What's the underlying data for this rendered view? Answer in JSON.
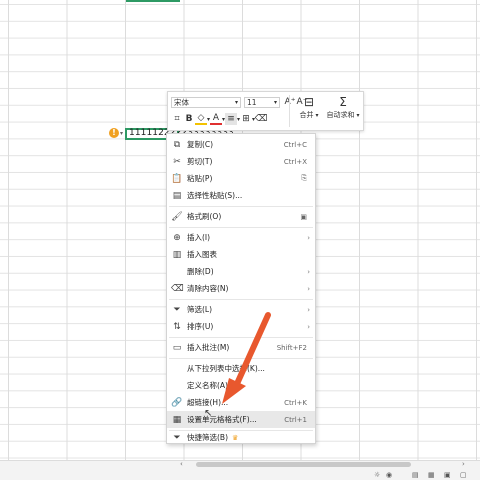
{
  "cell": {
    "value": "111112222233333333",
    "warning_glyph": "!"
  },
  "mini_toolbar": {
    "font_name": "宋体",
    "font_size": "11",
    "grow_font": "A⁺",
    "shrink_font": "A⁻",
    "bold": "B",
    "merge_label": "合并",
    "autosum_label": "自动求和"
  },
  "context_menu": {
    "items": [
      {
        "icon": "copy-icon",
        "label": "复制(C)",
        "shortcut": "Ctrl+C"
      },
      {
        "icon": "cut-icon",
        "label": "剪切(T)",
        "shortcut": "Ctrl+X"
      },
      {
        "icon": "paste-icon",
        "label": "粘贴(P)",
        "shortcut": ""
      },
      {
        "icon": "paste-special-icon",
        "label": "选择性粘贴(S)...",
        "shortcut": ""
      },
      {
        "icon": "format-painter-icon",
        "label": "格式刷(O)",
        "shortcut": ""
      },
      {
        "icon": "insert-icon",
        "label": "插入(I)",
        "shortcut": ""
      },
      {
        "icon": "chart-icon",
        "label": "插入图表",
        "shortcut": ""
      },
      {
        "icon": "delete-icon",
        "label": "删除(D)",
        "shortcut": ""
      },
      {
        "icon": "eraser-icon",
        "label": "清除内容(N)",
        "shortcut": ""
      },
      {
        "icon": "filter-icon",
        "label": "筛选(L)",
        "shortcut": ""
      },
      {
        "icon": "sort-icon",
        "label": "排序(U)",
        "shortcut": ""
      },
      {
        "icon": "comment-icon",
        "label": "插入批注(M)",
        "shortcut": "Shift+F2"
      },
      {
        "icon": "",
        "label": "从下拉列表中选择(K)...",
        "shortcut": ""
      },
      {
        "icon": "",
        "label": "定义名称(A)...",
        "shortcut": ""
      },
      {
        "icon": "link-icon",
        "label": "超链接(H)...",
        "shortcut": "Ctrl+K"
      },
      {
        "icon": "format-cells-icon",
        "label": "设置单元格格式(F)...",
        "shortcut": "Ctrl+1"
      },
      {
        "icon": "quick-filter-icon",
        "label": "快捷筛选(B)",
        "shortcut": ""
      }
    ]
  },
  "colors": {
    "accent": "#2e9a64",
    "arrow": "#e8582e"
  }
}
